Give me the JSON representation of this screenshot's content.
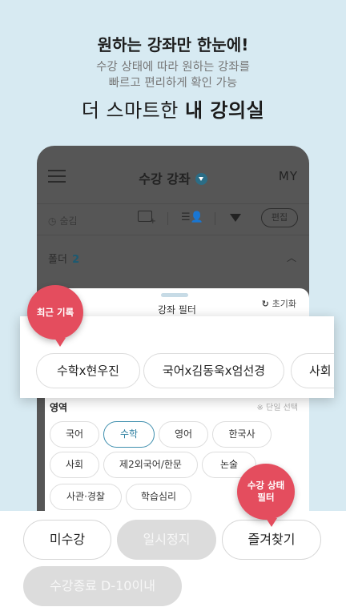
{
  "hero": {
    "title": "원하는 강좌만 한눈에!",
    "sub_line1": "수강 상태에 따라 원하는 강좌를",
    "sub_line2": "빠르고 편리하게 확인 가능",
    "tag_prefix": "더 스마트한 ",
    "tag_bold": "내 강의실"
  },
  "header": {
    "title": "수강 강좌",
    "right": "MY"
  },
  "toolbar": {
    "hide_label": "숨김",
    "edit_label": "편집"
  },
  "folder": {
    "label": "폴더",
    "count": "2",
    "chevron": "︿"
  },
  "filter_sheet": {
    "title": "강좌 필터",
    "reset_label": "초기화"
  },
  "recent": {
    "bubble_label": "최근 기록",
    "chips": [
      "수학x현우진",
      "국어x김동욱x엄선경",
      "사회"
    ]
  },
  "subject": {
    "label": "영역",
    "note": "※ 단일 선택",
    "chips": [
      "국어",
      "수학",
      "영어",
      "한국사",
      "사회",
      "제2외국어/한문",
      "논술",
      "사관·경찰",
      "학습심리"
    ],
    "selected": "수학"
  },
  "status": {
    "bubble_line1": "수강 상태",
    "bubble_line2": "필터",
    "buttons": [
      "미수강",
      "일시정지",
      "즐겨찾기",
      "수강종료 D-10이내"
    ]
  },
  "colors": {
    "background": "#d7eaf2",
    "accent_red": "#e44d5e",
    "accent_blue": "#2d7fa0"
  }
}
